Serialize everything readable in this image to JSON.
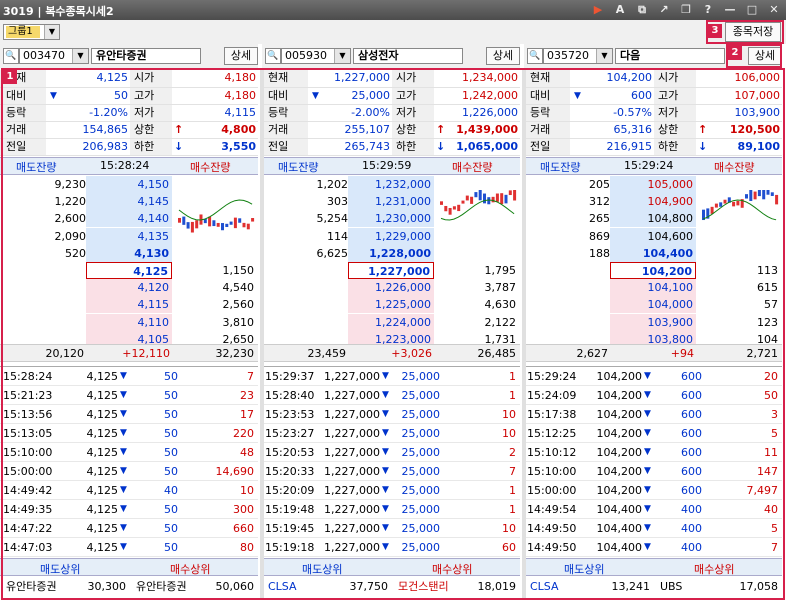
{
  "window": {
    "screen_no": "3019",
    "title": "복수종목시세2"
  },
  "toolbar": {
    "group_name": "그룹1",
    "save_label": "종목저장"
  },
  "badges": [
    "1",
    "2",
    "3"
  ],
  "labels": {
    "cur": "현재",
    "chg": "대비",
    "rate": "등락",
    "vol": "거래",
    "prev": "전일",
    "open": "시가",
    "high": "고가",
    "low": "저가",
    "upper": "상한",
    "lower": "하한",
    "ask_rem": "매도잔량",
    "bid_rem": "매수잔량",
    "sell_top": "매도상위",
    "buy_top": "매수상위",
    "detail": "상세"
  },
  "panels": [
    {
      "code": "003470",
      "name": "유안타증권",
      "summary": {
        "cur": "4,125",
        "chg": "50",
        "rate": "-1.20%",
        "vol": "154,865",
        "prev": "206,983",
        "open": "4,180",
        "high": "4,180",
        "low": "4,115",
        "upper": "4,800",
        "lower": "3,550"
      },
      "time": "15:28:24",
      "asks": [
        [
          "9,230",
          "4,150"
        ],
        [
          "1,220",
          "4,145"
        ],
        [
          "2,600",
          "4,140"
        ],
        [
          "2,090",
          "4,135"
        ],
        [
          "520",
          "4,130"
        ]
      ],
      "bids": [
        [
          "4,125",
          "1,150"
        ],
        [
          "4,120",
          "4,540"
        ],
        [
          "4,115",
          "2,560"
        ],
        [
          "4,110",
          "3,810"
        ],
        [
          "4,105",
          "2,650"
        ]
      ],
      "foot": {
        "ask_total": "20,120",
        "diff": "+12,110",
        "bid_total": "32,230"
      },
      "trades": [
        [
          "15:28:24",
          "4,125",
          "50",
          "7"
        ],
        [
          "15:21:23",
          "4,125",
          "50",
          "23"
        ],
        [
          "15:13:56",
          "4,125",
          "50",
          "17"
        ],
        [
          "15:13:05",
          "4,125",
          "50",
          "220"
        ],
        [
          "15:10:00",
          "4,125",
          "50",
          "48"
        ],
        [
          "15:00:00",
          "4,125",
          "50",
          "14,690"
        ],
        [
          "14:49:42",
          "4,125",
          "40",
          "10"
        ],
        [
          "14:49:35",
          "4,125",
          "50",
          "300"
        ],
        [
          "14:47:22",
          "4,125",
          "50",
          "660"
        ],
        [
          "14:47:03",
          "4,125",
          "50",
          "80"
        ]
      ],
      "broker": {
        "sell": "유안타증권",
        "sell_vol": "30,300",
        "buy": "유안타증권",
        "buy_vol": "50,060"
      }
    },
    {
      "code": "005930",
      "name": "삼성전자",
      "summary": {
        "cur": "1,227,000",
        "chg": "25,000",
        "rate": "-2.00%",
        "vol": "255,107",
        "prev": "265,743",
        "open": "1,234,000",
        "high": "1,242,000",
        "low": "1,226,000",
        "upper": "1,439,000",
        "lower": "1,065,000"
      },
      "time": "15:29:59",
      "asks": [
        [
          "1,202",
          "1,232,000"
        ],
        [
          "303",
          "1,231,000"
        ],
        [
          "5,254",
          "1,230,000"
        ],
        [
          "114",
          "1,229,000"
        ],
        [
          "6,625",
          "1,228,000"
        ]
      ],
      "bids": [
        [
          "1,227,000",
          "1,795"
        ],
        [
          "1,226,000",
          "3,787"
        ],
        [
          "1,225,000",
          "4,630"
        ],
        [
          "1,224,000",
          "2,122"
        ],
        [
          "1,223,000",
          "1,731"
        ]
      ],
      "foot": {
        "ask_total": "23,459",
        "diff": "+3,026",
        "bid_total": "26,485"
      },
      "trades": [
        [
          "15:29:37",
          "1,227,000",
          "25,000",
          "1"
        ],
        [
          "15:28:40",
          "1,227,000",
          "25,000",
          "1"
        ],
        [
          "15:23:53",
          "1,227,000",
          "25,000",
          "10"
        ],
        [
          "15:23:27",
          "1,227,000",
          "25,000",
          "10"
        ],
        [
          "15:20:53",
          "1,227,000",
          "25,000",
          "2"
        ],
        [
          "15:20:33",
          "1,227,000",
          "25,000",
          "7"
        ],
        [
          "15:20:09",
          "1,227,000",
          "25,000",
          "1"
        ],
        [
          "15:19:48",
          "1,227,000",
          "25,000",
          "1"
        ],
        [
          "15:19:45",
          "1,227,000",
          "25,000",
          "10"
        ],
        [
          "15:19:18",
          "1,227,000",
          "25,000",
          "60"
        ]
      ],
      "broker": {
        "sell": "CLSA",
        "sell_vol": "37,750",
        "buy": "모건스탠리",
        "buy_vol": "18,019"
      }
    },
    {
      "code": "035720",
      "name": "다음",
      "summary": {
        "cur": "104,200",
        "chg": "600",
        "rate": "-0.57%",
        "vol": "65,316",
        "prev": "216,915",
        "open": "106,000",
        "high": "107,000",
        "low": "103,900",
        "upper": "120,500",
        "lower": "89,100"
      },
      "time": "15:29:24",
      "asks": [
        [
          "205",
          "105,000"
        ],
        [
          "312",
          "104,900"
        ],
        [
          "265",
          "104,800"
        ],
        [
          "869",
          "104,600"
        ],
        [
          "188",
          "104,400"
        ]
      ],
      "bids": [
        [
          "104,200",
          "113"
        ],
        [
          "104,100",
          "615"
        ],
        [
          "104,000",
          "57"
        ],
        [
          "103,900",
          "123"
        ],
        [
          "103,800",
          "104"
        ]
      ],
      "foot": {
        "ask_total": "2,627",
        "diff": "+94",
        "bid_total": "2,721"
      },
      "trades": [
        [
          "15:29:24",
          "104,200",
          "600",
          "20"
        ],
        [
          "15:24:09",
          "104,200",
          "600",
          "50"
        ],
        [
          "15:17:38",
          "104,200",
          "600",
          "3"
        ],
        [
          "15:12:25",
          "104,200",
          "600",
          "5"
        ],
        [
          "15:10:12",
          "104,200",
          "600",
          "11"
        ],
        [
          "15:10:00",
          "104,200",
          "600",
          "147"
        ],
        [
          "15:00:00",
          "104,200",
          "600",
          "7,497"
        ],
        [
          "14:49:54",
          "104,400",
          "400",
          "40"
        ],
        [
          "14:49:50",
          "104,400",
          "400",
          "5"
        ],
        [
          "14:49:50",
          "104,400",
          "400",
          "7"
        ]
      ],
      "broker": {
        "sell": "CLSA",
        "sell_vol": "13,241",
        "buy": "UBS",
        "buy_vol": "17,058"
      }
    }
  ]
}
